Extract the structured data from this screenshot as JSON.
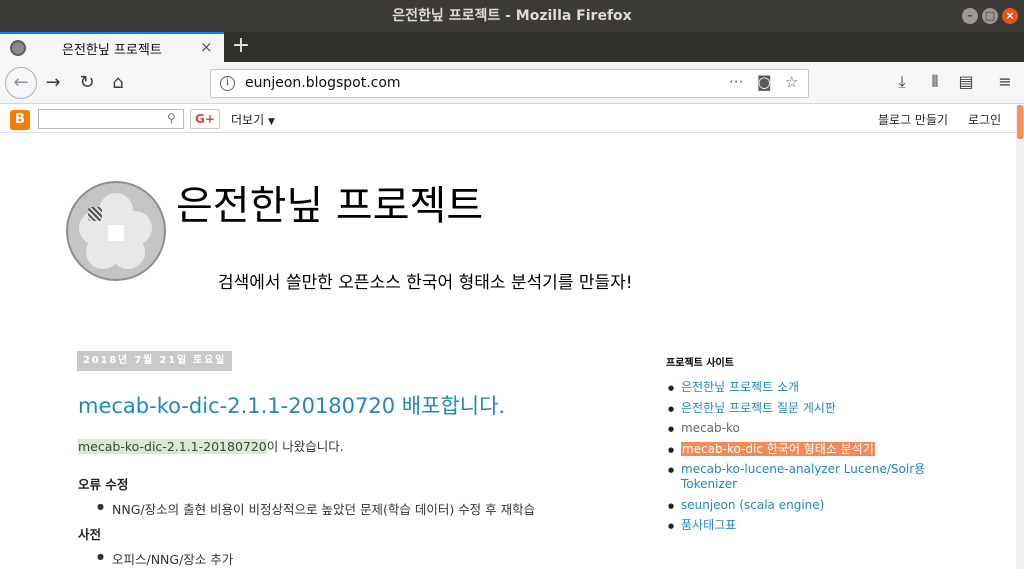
{
  "window": {
    "title": "은전한닢 프로젝트 - Mozilla Firefox"
  },
  "tabs": [
    {
      "label": "은전한닢 프로젝트",
      "active": true
    }
  ],
  "tab_close_glyph": "×",
  "new_tab_glyph": "+",
  "address_bar": {
    "url": "eunjeon.blogspot.com"
  },
  "blogger_navbar": {
    "logo_letter": "B",
    "gplus_label": "G+",
    "more_label": "더보기",
    "make_blog_label": "블로그 만들기",
    "login_label": "로그인"
  },
  "header": {
    "title": "은전한닢 프로젝트",
    "description": "검색에서 쓸만한 오픈소스 한국어 형태소 분석기를 만들자!"
  },
  "post": {
    "date": "2018년 7월 21일 토요일",
    "title": "mecab-ko-dic-2.1.1-20180720 배포합니다.",
    "intro_link": "mecab-ko-dic-2.1.1-20180720",
    "intro_suffix": "이 나왔습니다.",
    "sections": [
      {
        "heading": "오류 수정",
        "items": [
          "NNG/장소의 출현 비용이 비정상적으로 높았던 문제(학습 데이터) 수정 후 재학습"
        ]
      },
      {
        "heading": "사전",
        "items": [
          "오피스/NNG/장소 추가"
        ]
      }
    ]
  },
  "sidebar": {
    "heading": "프로젝트 사이트",
    "links": [
      {
        "label": "은전한닢 프로젝트 소개",
        "style": "link"
      },
      {
        "label": "은전한닢 프로젝트 질문 게시판",
        "style": "link"
      },
      {
        "label": "mecab-ko",
        "style": "plain"
      },
      {
        "label": "mecab-ko-dic 한국어 형태소 분석기",
        "style": "highlight"
      },
      {
        "label": "mecab-ko-lucene-analyzer Lucene/Solr용 Tokenizer",
        "style": "link"
      },
      {
        "label": "seunjeon (scala engine)",
        "style": "link"
      },
      {
        "label": "품사태그표",
        "style": "link"
      }
    ]
  },
  "colors": {
    "link": "#2288bb",
    "highlight": "#f08a59",
    "firefox_accent": "#0a84ff",
    "titlebar": "#3c3b37"
  }
}
